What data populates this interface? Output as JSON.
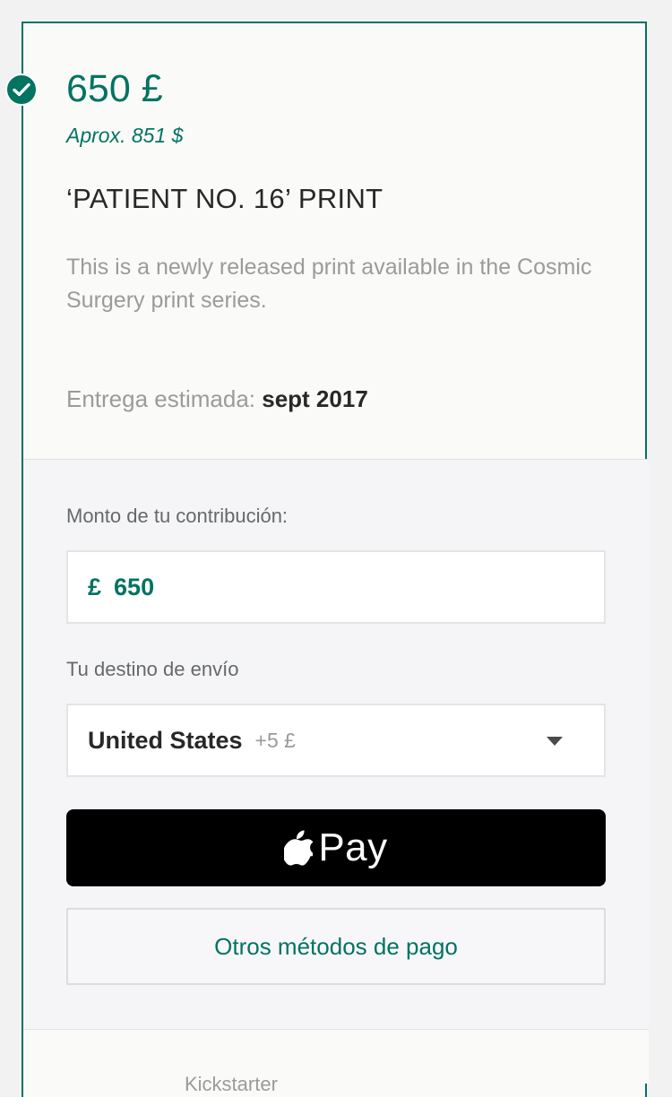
{
  "reward": {
    "price": "650 £",
    "approx": "Aprox. 851 $",
    "title": "‘PATIENT NO. 16’ PRINT",
    "description": "This is a newly released print available in the Cosmic Surgery print series.",
    "delivery_label": "Entrega estimada:",
    "delivery_value": "sept 2017",
    "selected_icon": "check-circle-icon"
  },
  "pledge": {
    "amount_label": "Monto de tu contribución:",
    "currency_symbol": "£",
    "amount_value": "650"
  },
  "shipping": {
    "label": "Tu destino de envío",
    "country": "United States",
    "extra_cost": "+5 £",
    "dropdown_icon": "caret-down-icon"
  },
  "payment": {
    "apple_pay_label": "Pay",
    "apple_icon": "apple-logo-icon",
    "other_methods_label": "Otros métodos de pago"
  },
  "footer": {
    "partial_text": "Kickstarter"
  },
  "colors": {
    "accent": "#037362",
    "text_dark": "#282828",
    "text_muted": "#9b9b9b",
    "apple_pay_bg": "#000000"
  }
}
